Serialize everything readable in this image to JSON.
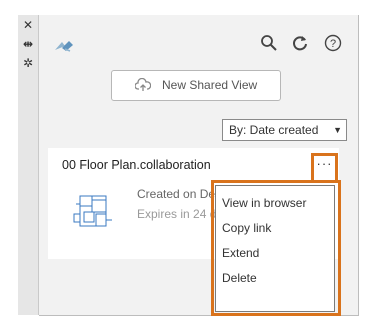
{
  "toolbar_strip": {
    "icons": [
      "close-icon",
      "collapse-panel-icon",
      "settings-icon"
    ]
  },
  "header": {
    "icons": [
      "shared-views-logo-icon",
      "search-icon",
      "refresh-icon",
      "help-icon"
    ]
  },
  "new_shared_view": {
    "label": "New Shared View",
    "icon": "cloud-upload-icon"
  },
  "sort": {
    "selected": "By: Date created"
  },
  "view_card": {
    "title": "00 Floor Plan.collaboration",
    "created_text": "Created on De",
    "expires_text": "Expires in 24 d",
    "more_label": "···"
  },
  "context_menu": {
    "items": [
      "View in browser",
      "Copy link",
      "Extend",
      "Delete"
    ]
  },
  "colors": {
    "highlight": "#d9731c",
    "panel_bg": "#f2f2f2",
    "strip_bg": "#e6e6e6"
  }
}
